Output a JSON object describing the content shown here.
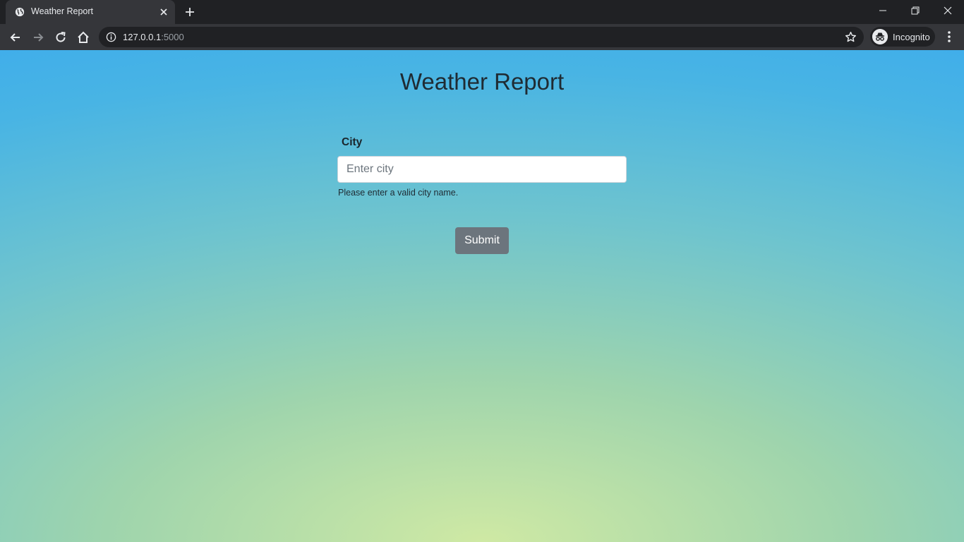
{
  "browser": {
    "tab": {
      "title": "Weather Report"
    },
    "address": {
      "host": "127.0.0.1",
      "port": ":5000"
    },
    "profile_label": "Incognito"
  },
  "page": {
    "heading": "Weather Report",
    "form": {
      "city_label": "City",
      "city_value": "",
      "city_placeholder": "Enter city",
      "help_text": "Please enter a valid city name.",
      "submit_label": "Submit"
    }
  },
  "colors": {
    "gradient_top": "#3aa9ef",
    "gradient_bottom": "#cfe9a4",
    "submit_button": "#6c757d",
    "chrome_dark": "#202124",
    "chrome_toolbar": "#35363a"
  },
  "icons": [
    "globe-icon",
    "close-icon",
    "plus-icon",
    "minimize-icon",
    "restore-icon",
    "window-close-icon",
    "back-arrow-icon",
    "forward-arrow-icon",
    "reload-icon",
    "home-icon",
    "info-icon",
    "star-icon",
    "incognito-icon",
    "kebab-menu-icon"
  ]
}
